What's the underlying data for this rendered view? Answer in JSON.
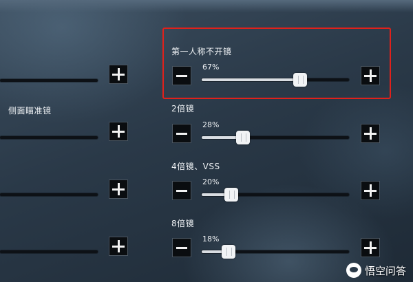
{
  "settings": {
    "first_person_unscoped": {
      "label": "第一人称不开镜",
      "percent_text": "67%",
      "value": 0.67
    },
    "side_scope": {
      "label": "侧面瞄准镜"
    },
    "scope_2x": {
      "label": "2倍镜",
      "percent_text": "28%",
      "value": 0.28
    },
    "scope_4x_vss": {
      "label": "4倍镜、VSS",
      "percent_text": "20%",
      "value": 0.2
    },
    "scope_8x": {
      "label": "8倍镜",
      "percent_text": "18%",
      "value": 0.18
    }
  },
  "left_column_values": [
    0.0,
    0.0,
    0.0,
    0.0
  ],
  "highlight_color": "#e0211b",
  "watermark": {
    "text": "悟空问答"
  }
}
